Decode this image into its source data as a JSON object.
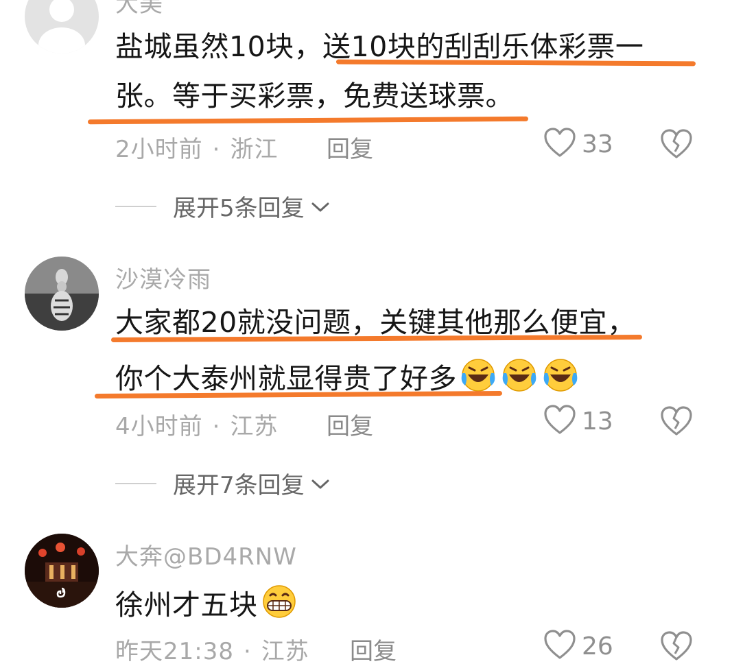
{
  "comments": [
    {
      "username": "大美",
      "lines": [
        "盐城虽然10块，送10块的刮刮乐体彩票一",
        "张。等于买彩票，免费送球票。"
      ],
      "time": "2小时前",
      "location": "浙江",
      "reply_label": "回复",
      "likes": "33",
      "expand_label": "展开5条回复"
    },
    {
      "username": "沙漠冷雨",
      "lines": [
        "大家都20就没问题，关键其他那么便宜，",
        "你个大泰州就显得贵了好多"
      ],
      "time": "4小时前",
      "location": "江苏",
      "reply_label": "回复",
      "likes": "13",
      "expand_label": "展开7条回复"
    },
    {
      "username": "大奔@BD4RNW",
      "lines": [
        "徐州才五块"
      ],
      "time": "昨天21:38",
      "location": "江苏",
      "reply_label": "回复",
      "likes": "26"
    }
  ],
  "meta_separator": "·",
  "icons": {
    "like": "heart-outline-icon",
    "dislike": "broken-heart-icon",
    "expand": "chevron-down-icon",
    "emoji_laugh_cry": "laughing-crying-emoji",
    "emoji_grin": "grinning-emoji"
  },
  "colors": {
    "underline": "#f47a2c",
    "meta_text": "#a8a8a8",
    "body_text": "#161616"
  }
}
